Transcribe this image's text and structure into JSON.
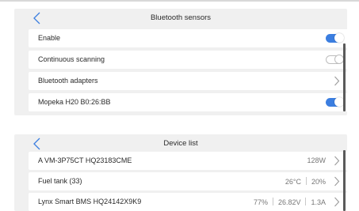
{
  "bluetooth_sensors": {
    "title": "Bluetooth sensors",
    "items": [
      {
        "label": "Enable",
        "control": "toggle",
        "state": "on"
      },
      {
        "label": "Continuous scanning",
        "control": "toggle",
        "state": "off"
      },
      {
        "label": "Bluetooth adapters",
        "control": "chevron"
      },
      {
        "label": "Mopeka H20 B0:26:BB",
        "control": "toggle",
        "state": "on"
      }
    ]
  },
  "device_list": {
    "title": "Device list",
    "items": [
      {
        "label": "A VM-3P75CT HQ23183CME",
        "values": [
          "128W"
        ]
      },
      {
        "label": "Fuel tank (33)",
        "values": [
          "26°C",
          "20%"
        ]
      },
      {
        "label": "Lynx Smart BMS HQ24142X9K9",
        "values": [
          "77%",
          "26.82V",
          "1.3A"
        ]
      }
    ]
  },
  "colors": {
    "accent": "#3b7ee0",
    "panel_bg": "#f0f0f0",
    "row_bg": "#ffffff"
  },
  "icons": {
    "back": "chevron-left-icon",
    "forward": "chevron-right-icon"
  }
}
